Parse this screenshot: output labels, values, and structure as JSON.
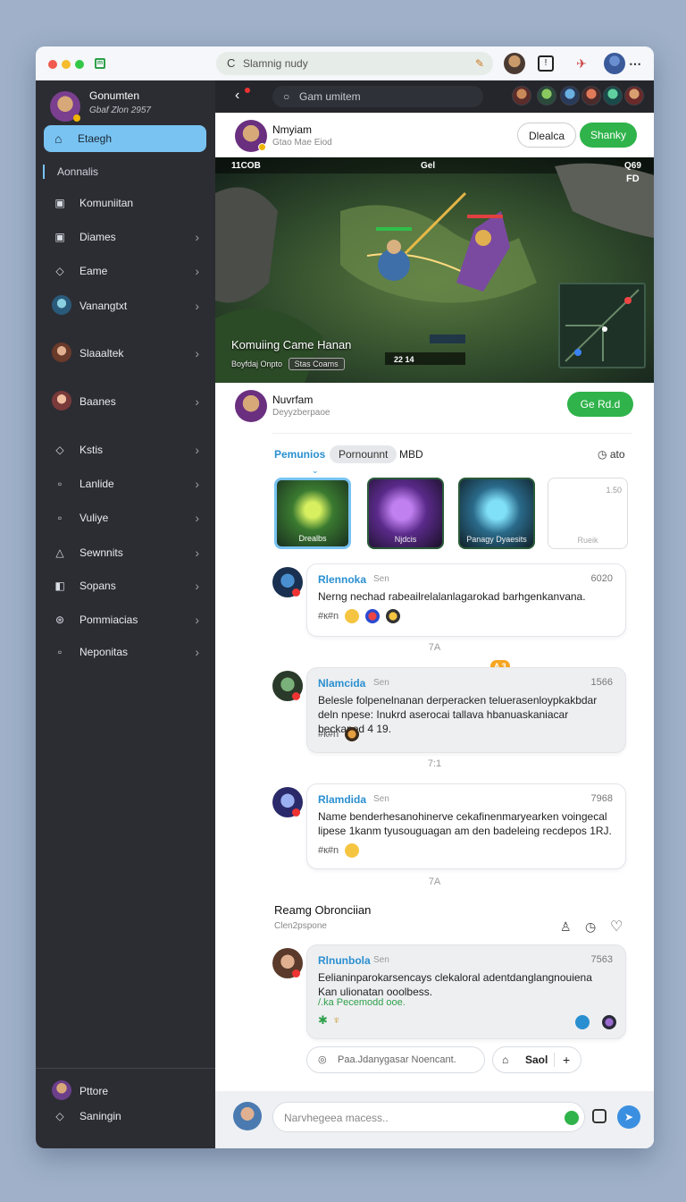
{
  "browser": {
    "url_text": "Slamnig nudy"
  },
  "sidebar": {
    "user_name": "Gonumten",
    "user_sub": "Gbaf Zlon 2957",
    "active_item": "Etaegh",
    "section_label": "Aonnalis",
    "items": [
      {
        "label": "Komuniitan",
        "icon": "calendar-icon",
        "chevron": false
      },
      {
        "label": "Diames",
        "icon": "calendar-icon",
        "chevron": true
      },
      {
        "label": "Eame",
        "icon": "location-icon",
        "chevron": true
      },
      {
        "label": "Vanangtxt",
        "icon": "avatar",
        "chevron": true
      },
      {
        "label": "Slaaaltek",
        "icon": "avatar",
        "chevron": true
      },
      {
        "label": "Baanes",
        "icon": "avatar",
        "chevron": true
      },
      {
        "label": "Kstis",
        "icon": "location-icon",
        "chevron": true
      },
      {
        "label": "Lanlide",
        "icon": "square-icon",
        "chevron": true
      },
      {
        "label": "Vuliye",
        "icon": "square-icon",
        "chevron": true
      },
      {
        "label": "Sewnnits",
        "icon": "triangle-icon",
        "chevron": true
      },
      {
        "label": "Sopans",
        "icon": "bag-icon",
        "chevron": true
      },
      {
        "label": "Pommiacias",
        "icon": "link-icon",
        "chevron": true
      },
      {
        "label": "Neponitas",
        "icon": "square-icon",
        "chevron": true
      }
    ],
    "footer": {
      "profile_label": "Pttore",
      "settings_label": "Saningin"
    }
  },
  "topbar": {
    "search_placeholder": "Gam umitem"
  },
  "streamer": {
    "name": "Nmyiam",
    "sub": "Gtao Mae Eiod",
    "secondary_btn": "Dlealca",
    "primary_btn": "Shanky"
  },
  "game": {
    "hud_left": "11COB",
    "hud_mid": "Gel",
    "hud_right": "Q69",
    "hud_right2": "FD",
    "overlay_title": "Komuiing Came Hanan",
    "overlay_sub": "Boyfdaj Onpto",
    "overlay_chip": "Stas Coams",
    "bottom_stats": "22   14"
  },
  "section": {
    "name": "Nuvrfam",
    "sub": "Deyyzberpaoe",
    "action_btn": "Ge Rd.d"
  },
  "tabs": {
    "active": "Pemunios",
    "pill": "Pornounnt",
    "third": "MBD",
    "right": "ato"
  },
  "cards": [
    {
      "label": "Drealbs"
    },
    {
      "label": "Njdcis"
    },
    {
      "label": "Panagy Dyaesits"
    },
    {
      "label": "Rueik",
      "count": "1.50"
    }
  ],
  "messages": [
    {
      "name": "Rlennoka",
      "tag": "Sen",
      "time": "6020",
      "text": "Nerng nechad rabeailrelalanlagarokad barhgenkanvana.",
      "foot": "#к#n",
      "after": "7A"
    },
    {
      "name": "Nlamcida",
      "tag": "Sen",
      "time": "1566",
      "text": "Belesle folpenelnanan derperacken teluerasenloypkakbdar deln npese: Inukrd aserocai tallava hbanuaskaniacar beckaped 4 19.",
      "foot": "#к#n",
      "badge": "A 3",
      "after": "7:1"
    },
    {
      "name": "Rlamdida",
      "tag": "Sen",
      "time": "7968",
      "text": "Name benderhesanohinerve cekafinenmaryearken voingecal lipese 1kanm tyusouguagan am den badeleing recdepos 1RJ.",
      "foot": "#к#n",
      "after": "7A"
    }
  ],
  "thread": {
    "title": "Reamg Obronciian",
    "sub": "Clen2pspone",
    "msg": {
      "name": "Rlnunbola",
      "tag": "Sen",
      "time": "7563",
      "text": "Eelianinparokarsencays clekaloral adentdanglangnouiena Kan ulionatan ooolbess.",
      "link": "/.ka Pecemodd ooe."
    },
    "reply_placeholder": "Paa.Jdanygasar Noencant.",
    "send_btn": "Saol"
  },
  "composer": {
    "placeholder": "Narvhegeea macess.."
  },
  "colors": {
    "accent": "#78c3f2",
    "green": "#2fb34a",
    "sidebar": "#2c2d33",
    "link": "#2a8fd0"
  }
}
